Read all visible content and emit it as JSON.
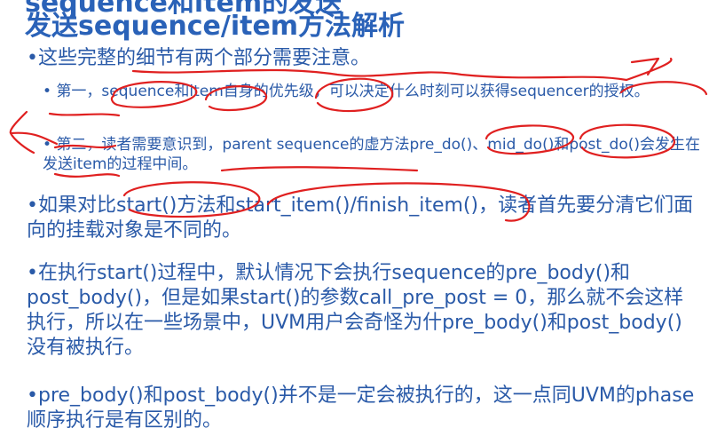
{
  "slide": {
    "title_partial": "sequence和item的发送",
    "title": "发送sequence/item方法解析",
    "bullet_glyph": "•",
    "sub_bullet_glyph": "•",
    "intro": "这些完整的细节有两个部分需要注意。",
    "first": "第一，sequence和item自身的优先级，可以决定什么时刻可以获得sequencer的授权。",
    "second": "第二，读者需要意识到，parent sequence的虚方法pre_do()、mid_do()和post_do()会发生在发送item的过程中间。",
    "compare": "如果对比start()方法和start_item()/finish_item()，读者首先要分清它们面向的挂载对象是不同的。",
    "start_process": "在执行start()过程中，默认情况下会执行sequence的pre_body()和post_body()，但是如果start()的参数call_pre_post = 0，那么就不会这样执行，所以在一些场景中，UVM用户会奇怪为什pre_body()和post_body()没有被执行。",
    "prebody_note": "pre_body()和post_body()并不是一定会被执行的，这一点同UVM的phase顺序执行是有区别的。"
  },
  "colors": {
    "text": "#2a5aa8",
    "title": "#2a62b8",
    "annotation": "#e02020"
  }
}
